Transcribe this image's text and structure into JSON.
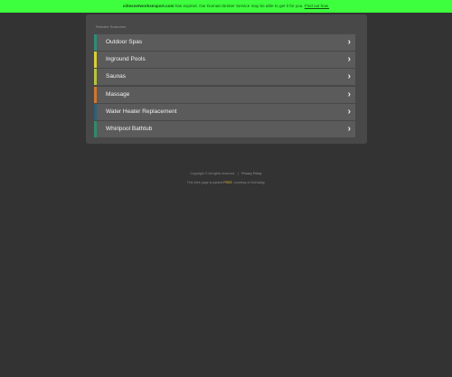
{
  "banner": {
    "domain": "citiesnetworksexport.com",
    "text": " has expired. Our Domain Broker Service may be able to get it for you.",
    "link": "Find out how."
  },
  "panel": {
    "title": "Related Searches",
    "items": [
      {
        "label": "Outdoor Spas",
        "accent": "#2e8b7a"
      },
      {
        "label": "Inground Pools",
        "accent": "#d8cf3a"
      },
      {
        "label": "Saunas",
        "accent": "#b6c43a"
      },
      {
        "label": "Massage",
        "accent": "#d2762e"
      },
      {
        "label": "Water Heater Replacement",
        "accent": "#2f5d78"
      },
      {
        "label": "Whirlpool Bathtub",
        "accent": "#2e8b6a"
      }
    ],
    "chevron": "›"
  },
  "footer": {
    "copyright": "Copyright © All rights reserved.",
    "separator": "|",
    "privacy": "Privacy Policy",
    "note_prefix": "This Web page is parked ",
    "note_highlight": "FREE",
    "note_suffix": ", courtesy of GoDaddy."
  }
}
